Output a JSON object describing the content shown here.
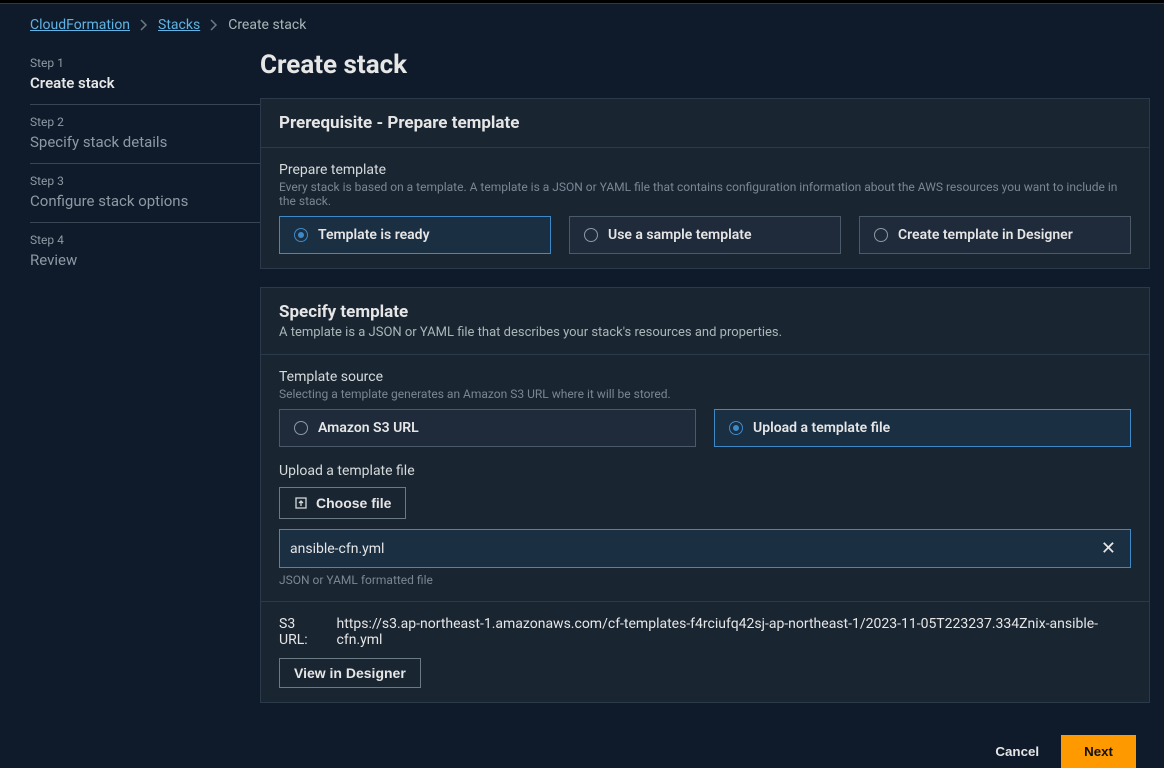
{
  "breadcrumb": {
    "root": "CloudFormation",
    "stacks": "Stacks",
    "current": "Create stack"
  },
  "wizard": {
    "steps": [
      {
        "num": "Step 1",
        "title": "Create stack"
      },
      {
        "num": "Step 2",
        "title": "Specify stack details"
      },
      {
        "num": "Step 3",
        "title": "Configure stack options"
      },
      {
        "num": "Step 4",
        "title": "Review"
      }
    ]
  },
  "page_title": "Create stack",
  "prereq": {
    "heading": "Prerequisite - Prepare template",
    "field_label": "Prepare template",
    "field_help": "Every stack is based on a template. A template is a JSON or YAML file that contains configuration information about the AWS resources you want to include in the stack.",
    "options": {
      "ready": "Template is ready",
      "sample": "Use a sample template",
      "designer": "Create template in Designer"
    }
  },
  "specify": {
    "heading": "Specify template",
    "sub": "A template is a JSON or YAML file that describes your stack's resources and properties.",
    "source_label": "Template source",
    "source_help": "Selecting a template generates an Amazon S3 URL where it will be stored.",
    "options": {
      "s3url": "Amazon S3 URL",
      "upload": "Upload a template file"
    },
    "upload_label": "Upload a template file",
    "choose_file": "Choose file",
    "filename": "ansible-cfn.yml",
    "filename_help": "JSON or YAML formatted file",
    "s3_label": "S3 URL:",
    "s3_url": "https://s3.ap-northeast-1.amazonaws.com/cf-templates-f4rciufq42sj-ap-northeast-1/2023-11-05T223237.334Znix-ansible-cfn.yml",
    "view_designer": "View in Designer"
  },
  "footer": {
    "cancel": "Cancel",
    "next": "Next"
  }
}
